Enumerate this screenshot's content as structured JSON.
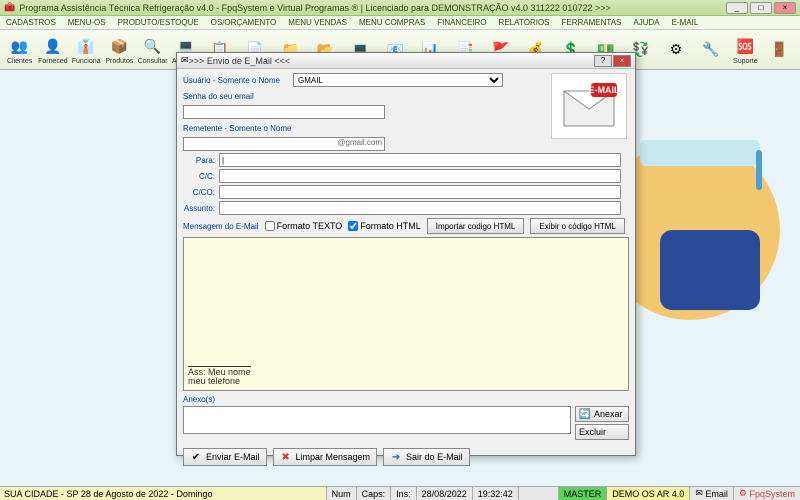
{
  "titlebar": "Programa Assistência Técnica Refrigeração v4.0 - FpqSystem e Virtual Programas ® | Licenciado para  DEMONSTRAÇÃO v4.0 311222 010722 >>>",
  "menu": [
    "CADASTROS",
    "MENU-OS",
    "PRODUTO/ESTOQUE",
    "OS/ORÇAMENTO",
    "MENU VENDAS",
    "MENU COMPRAS",
    "FINANCEIRO",
    "RELATÓRIOS",
    "FERRAMENTAS",
    "AJUDA",
    "E-MAIL"
  ],
  "toolbar": [
    {
      "label": "Clientes",
      "icon": "👥"
    },
    {
      "label": "Forneced",
      "icon": "👤"
    },
    {
      "label": "Funciona",
      "icon": "👔"
    },
    {
      "label": "Produtos",
      "icon": "📦"
    },
    {
      "label": "Consultar",
      "icon": "🔍"
    },
    {
      "label": "Aparelho",
      "icon": "💻"
    },
    {
      "label": "",
      "icon": "📋"
    },
    {
      "label": "",
      "icon": "📄"
    },
    {
      "label": "",
      "icon": "📁"
    },
    {
      "label": "",
      "icon": "📂"
    },
    {
      "label": "",
      "icon": "💻"
    },
    {
      "label": "",
      "icon": "📧"
    },
    {
      "label": "",
      "icon": "📊"
    },
    {
      "label": "",
      "icon": "📑"
    },
    {
      "label": "",
      "icon": "🚩"
    },
    {
      "label": "",
      "icon": "💰"
    },
    {
      "label": "",
      "icon": "💲"
    },
    {
      "label": "",
      "icon": "💵"
    },
    {
      "label": "",
      "icon": "💱"
    },
    {
      "label": "",
      "icon": "⚙"
    },
    {
      "label": "",
      "icon": "🔧"
    },
    {
      "label": "Suporte",
      "icon": "🆘"
    },
    {
      "label": "",
      "icon": "🚪"
    }
  ],
  "dialog": {
    "title": ">>> Envio de E_Mail <<<",
    "user_label": "Usuário - Somente o Nome",
    "provider": "GMAIL",
    "pass_label": "Senha do seu email",
    "sender_label": "Remetente - Somente o Nome",
    "sender_suffix": "@gmail.com",
    "to": "Para:",
    "cc": "C/C:",
    "cco": "C/CO:",
    "subject": "Assunto:",
    "msg_label": "Mensagem do E-Mail",
    "fmt_text": "Formato TEXTO",
    "fmt_html": "Formato HTML",
    "import_btn": "Importar codigo HTML",
    "show_btn": "Exibir o código HTML",
    "sig_line1": "Ass: Meu  nome",
    "sig_line2": "meu telefone",
    "anexo_label": "Anexo(s)",
    "anexar": "Anexar",
    "excluir": "Excluir",
    "send": "Enviar E-Mail",
    "clear": "Limpar Mensagem",
    "exit": "Sair do E-Mail"
  },
  "status": {
    "left": "SUA CIDADE - SP 28 de Agosto de 2022 - Domingo",
    "num": "Num",
    "caps": "Caps:",
    "ins": "Ins:",
    "date": "28/08/2022",
    "time": "19:32:42",
    "master": "MASTER",
    "demo": "DEMO OS AR 4.0",
    "email": "Email",
    "brand": "FpqSystem"
  }
}
